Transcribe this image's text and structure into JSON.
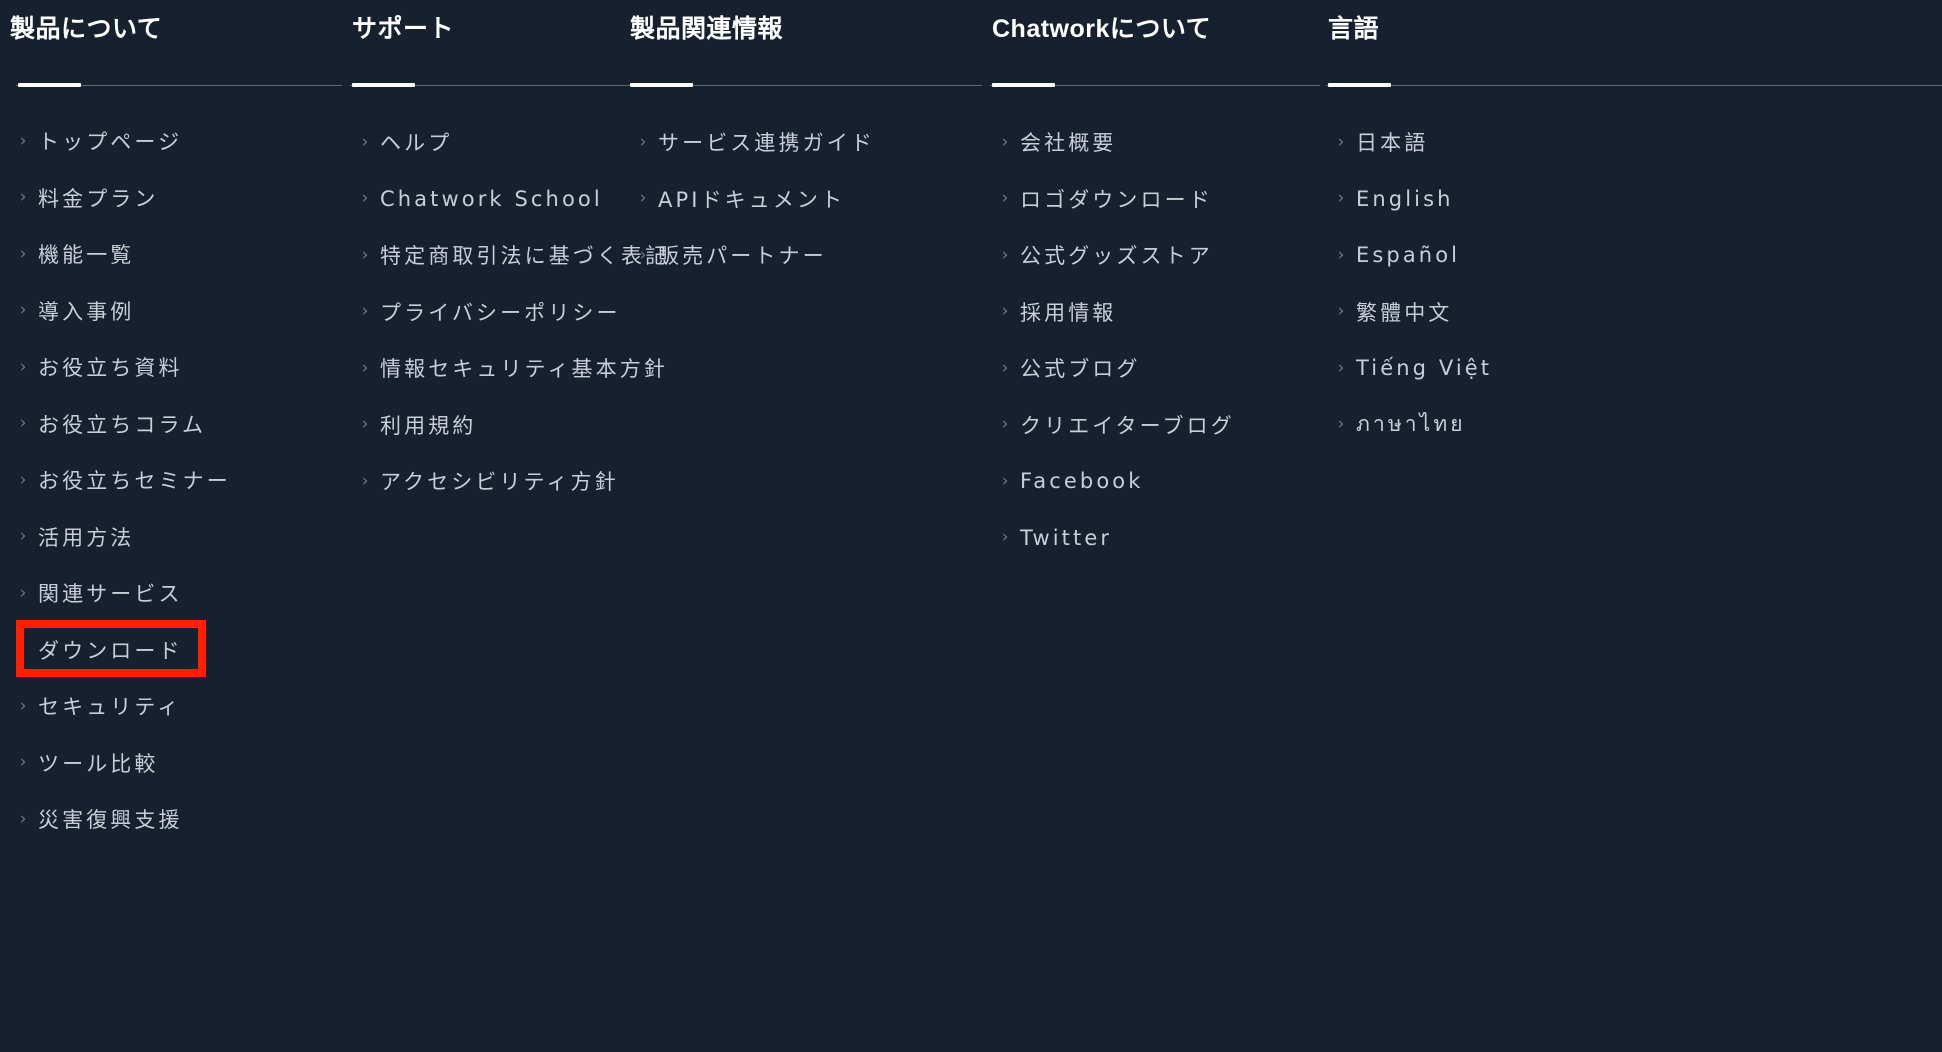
{
  "theme": {
    "background": "#16202e",
    "title_color": "#ffffff",
    "link_color": "#c9ced6",
    "chevron_color": "#6e7a88",
    "rule_color": "#5d6875",
    "accent_color": "#ffffff",
    "highlight_color": "#ff1e00"
  },
  "icons": {
    "chevron": "›",
    "chevron_name": "chevron-right-icon"
  },
  "columns": [
    {
      "title": "製品について",
      "items": [
        {
          "label": "トップページ",
          "highlighted": false
        },
        {
          "label": "料金プラン",
          "highlighted": false
        },
        {
          "label": "機能一覧",
          "highlighted": false
        },
        {
          "label": "導入事例",
          "highlighted": false
        },
        {
          "label": "お役立ち資料",
          "highlighted": false
        },
        {
          "label": "お役立ちコラム",
          "highlighted": false
        },
        {
          "label": "お役立ちセミナー",
          "highlighted": false
        },
        {
          "label": "活用方法",
          "highlighted": false
        },
        {
          "label": "関連サービス",
          "highlighted": false
        },
        {
          "label": "ダウンロード",
          "highlighted": true
        },
        {
          "label": "セキュリティ",
          "highlighted": false
        },
        {
          "label": "ツール比較",
          "highlighted": false
        },
        {
          "label": "災害復興支援",
          "highlighted": false
        }
      ]
    },
    {
      "title": "サポート",
      "items": [
        {
          "label": "ヘルプ",
          "highlighted": false
        },
        {
          "label": "Chatwork School",
          "highlighted": false
        },
        {
          "label": "特定商取引法に基づく表記",
          "highlighted": false
        },
        {
          "label": "プライバシーポリシー",
          "highlighted": false
        },
        {
          "label": "情報セキュリティ基本方針",
          "highlighted": false
        },
        {
          "label": "利用規約",
          "highlighted": false
        },
        {
          "label": "アクセシビリティ方針",
          "highlighted": false
        }
      ]
    },
    {
      "title": "製品関連情報",
      "items": [
        {
          "label": "サービス連携ガイド",
          "highlighted": false
        },
        {
          "label": "APIドキュメント",
          "highlighted": false
        },
        {
          "label": "販売パートナー",
          "highlighted": false
        }
      ]
    },
    {
      "title": "Chatworkについて",
      "items": [
        {
          "label": "会社概要",
          "highlighted": false
        },
        {
          "label": "ロゴダウンロード",
          "highlighted": false
        },
        {
          "label": "公式グッズストア",
          "highlighted": false
        },
        {
          "label": "採用情報",
          "highlighted": false
        },
        {
          "label": "公式ブログ",
          "highlighted": false
        },
        {
          "label": "クリエイターブログ",
          "highlighted": false
        },
        {
          "label": "Facebook",
          "highlighted": false
        },
        {
          "label": "Twitter",
          "highlighted": false
        }
      ]
    },
    {
      "title": "言語",
      "items": [
        {
          "label": "日本語",
          "highlighted": false
        },
        {
          "label": "English",
          "highlighted": false
        },
        {
          "label": "Español",
          "highlighted": false
        },
        {
          "label": "繁體中文",
          "highlighted": false
        },
        {
          "label": "Tiếng Việt",
          "highlighted": false
        },
        {
          "label": "ภาษาไทย",
          "highlighted": false
        }
      ]
    }
  ]
}
